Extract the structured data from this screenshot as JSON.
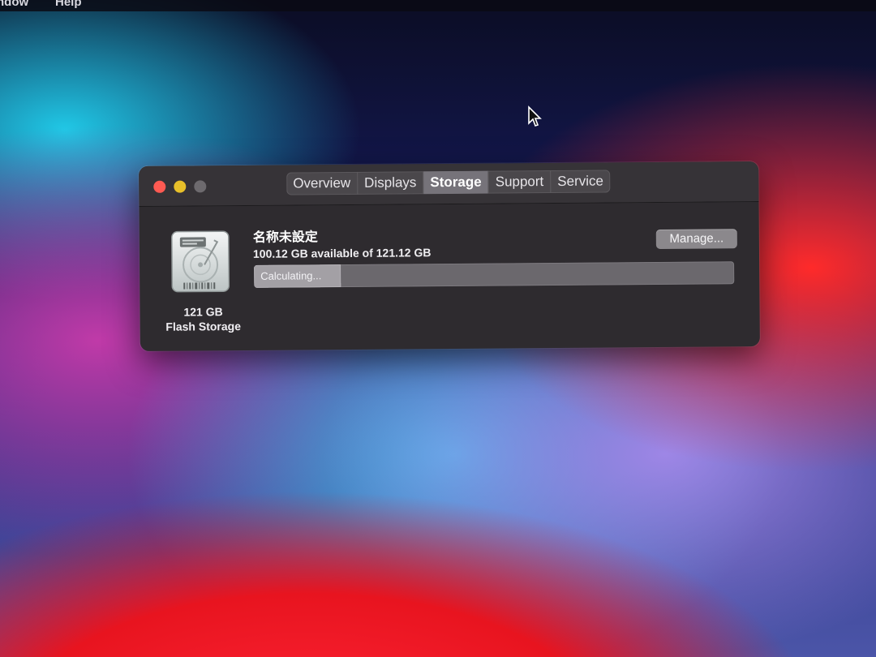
{
  "menubar": {
    "items": [
      "ndow",
      "Help"
    ]
  },
  "window": {
    "tabs": [
      {
        "label": "Overview",
        "active": false
      },
      {
        "label": "Displays",
        "active": false
      },
      {
        "label": "Storage",
        "active": true
      },
      {
        "label": "Support",
        "active": false
      },
      {
        "label": "Service",
        "active": false
      }
    ],
    "disk": {
      "icon": "hard-drive-icon",
      "size_label": "121 GB",
      "type_label": "Flash Storage"
    },
    "volume": {
      "name": "名称未設定",
      "availability": "100.12 GB available of 121.12 GB",
      "manage_label": "Manage...",
      "progress_label": "Calculating...",
      "progress_fraction": 0.18
    }
  }
}
